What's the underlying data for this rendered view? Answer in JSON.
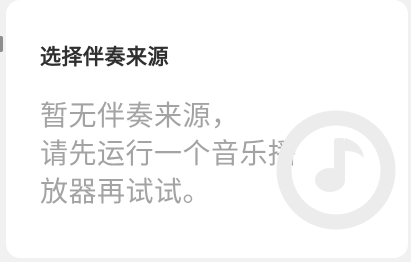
{
  "dialog": {
    "title": "选择伴奏来源",
    "message_lines": [
      "暂无伴奏来源，",
      "请先运行一个音乐播",
      "放器再试试。"
    ],
    "watermark_icon": "music-note-circle-icon"
  },
  "colors": {
    "page_background": "#f1f1f1",
    "card_background": "#ffffff",
    "title_text": "#2f2f2f",
    "message_text": "#a3a3a3",
    "watermark": "#ececec"
  }
}
